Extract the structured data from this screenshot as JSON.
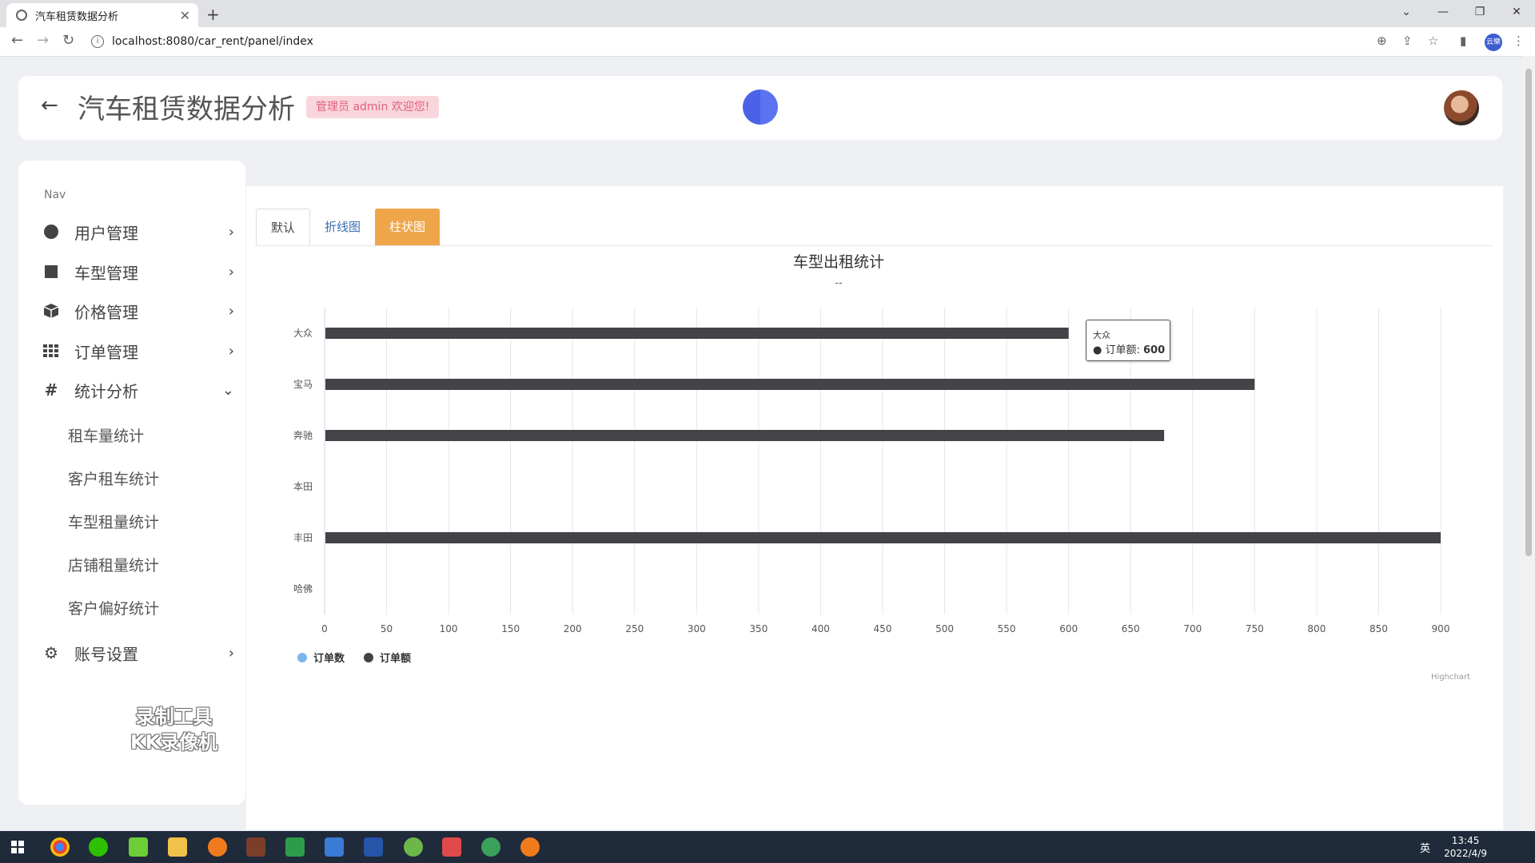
{
  "browser": {
    "tab_title": "汽车租赁数据分析",
    "url": "localhost:8080/car_rent/panel/index",
    "profile_label": "云樂"
  },
  "header": {
    "title": "汽车租赁数据分析",
    "badge": "管理员 admin 欢迎您!"
  },
  "sidebar": {
    "nav_label": "Nav",
    "items": [
      {
        "label": "用户管理",
        "icon": "circle-icon"
      },
      {
        "label": "车型管理",
        "icon": "square-icon"
      },
      {
        "label": "价格管理",
        "icon": "box-icon"
      },
      {
        "label": "订单管理",
        "icon": "grid-icon"
      },
      {
        "label": "统计分析",
        "icon": "hash-icon"
      },
      {
        "label": "账号设置",
        "icon": "gear-icon"
      }
    ],
    "sub_items": [
      "租车量统计",
      "客户租车统计",
      "车型租量统计",
      "店铺租量统计",
      "客户偏好统计"
    ],
    "watermark": [
      "录制工具",
      "KK录像机"
    ]
  },
  "tabs": [
    "默认",
    "折线图",
    "柱状图"
  ],
  "chart_data": {
    "type": "bar",
    "orientation": "horizontal",
    "title": "车型出租统计",
    "subtitle": "--",
    "categories": [
      "大众",
      "宝马",
      "奔驰",
      "本田",
      "丰田",
      "哈佛"
    ],
    "series": [
      {
        "name": "订单数",
        "color": "#7cb5ec",
        "values": [
          null,
          null,
          null,
          null,
          null,
          null
        ]
      },
      {
        "name": "订单额",
        "color": "#434348",
        "values": [
          600,
          750,
          677,
          null,
          900,
          null
        ]
      }
    ],
    "xlim": [
      0,
      900
    ],
    "ticks": [
      0,
      50,
      100,
      150,
      200,
      250,
      300,
      350,
      400,
      450,
      500,
      550,
      600,
      650,
      700,
      750,
      800,
      850,
      900
    ],
    "legend": "bottom-left",
    "credit": "Highchart",
    "tooltip": {
      "category": "大众",
      "series": "订单额",
      "value": "600"
    }
  },
  "taskbar": {
    "time": "13:45",
    "date": "2022/4/9",
    "ime": "英"
  }
}
